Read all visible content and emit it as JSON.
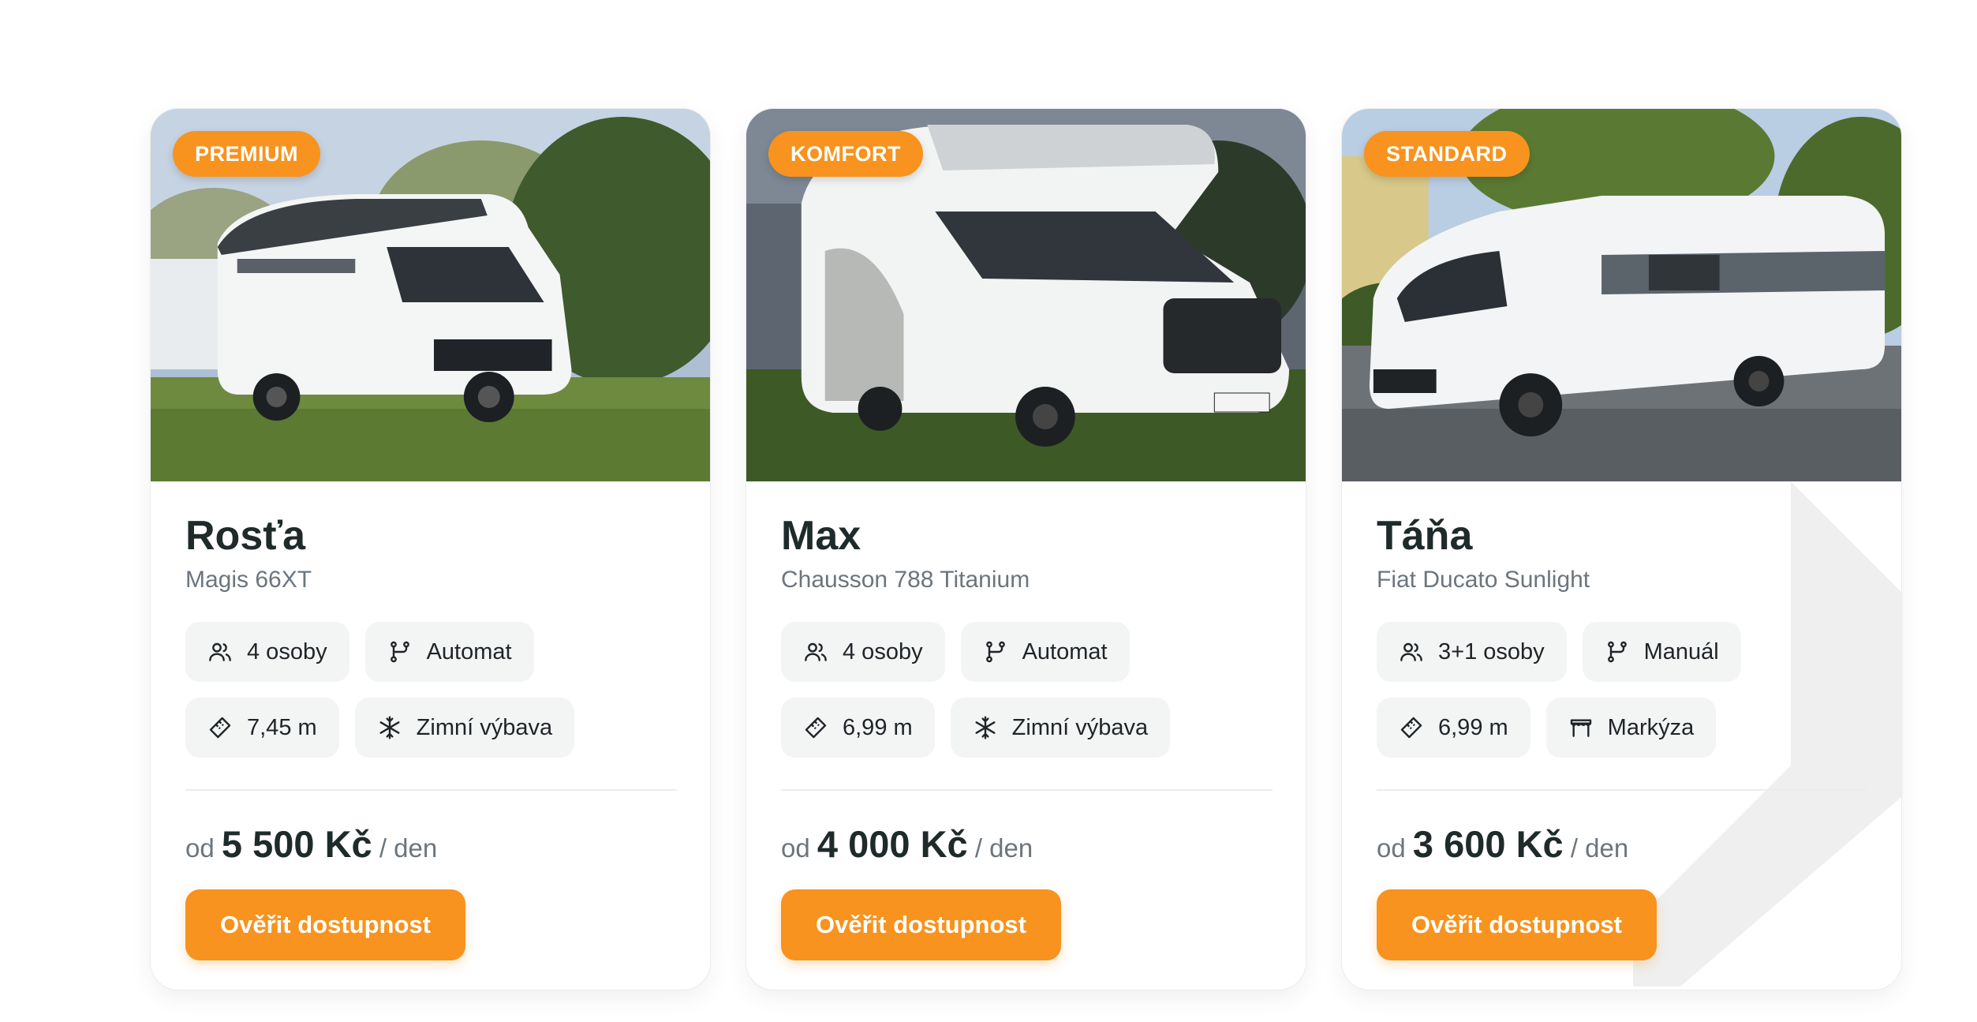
{
  "cards": [
    {
      "badge": "PREMIUM",
      "name": "Rosťa",
      "model": "Magis 66XT",
      "features": [
        {
          "icon": "people-icon",
          "label": "4 osoby"
        },
        {
          "icon": "gearshift-icon",
          "label": "Automat"
        },
        {
          "icon": "ruler-icon",
          "label": "7,45 m"
        },
        {
          "icon": "snowflake-icon",
          "label": "Zimní výbava"
        }
      ],
      "price_prefix": "od",
      "price": "5 500 Kč",
      "price_suffix": "/ den",
      "cta": "Ověřit dostupnost"
    },
    {
      "badge": "KOMFORT",
      "name": "Max",
      "model": "Chausson 788 Titanium",
      "features": [
        {
          "icon": "people-icon",
          "label": "4 osoby"
        },
        {
          "icon": "gearshift-icon",
          "label": "Automat"
        },
        {
          "icon": "ruler-icon",
          "label": "6,99 m"
        },
        {
          "icon": "snowflake-icon",
          "label": "Zimní výbava"
        }
      ],
      "price_prefix": "od",
      "price": "4 000 Kč",
      "price_suffix": "/ den",
      "cta": "Ověřit dostupnost"
    },
    {
      "badge": "STANDARD",
      "name": "Táňa",
      "model": "Fiat Ducato Sunlight",
      "features": [
        {
          "icon": "people-icon",
          "label": "3+1 osoby"
        },
        {
          "icon": "gearshift-icon",
          "label": "Manuál"
        },
        {
          "icon": "ruler-icon",
          "label": "6,99 m"
        },
        {
          "icon": "awning-icon",
          "label": "Markýza"
        }
      ],
      "price_prefix": "od",
      "price": "3 600 Kč",
      "price_suffix": "/ den",
      "cta": "Ověřit dostupnost"
    }
  ],
  "colors": {
    "accent": "#f7931e",
    "chip_bg": "#f3f4f4",
    "title": "#1f2a2a",
    "muted": "#6c757d"
  }
}
